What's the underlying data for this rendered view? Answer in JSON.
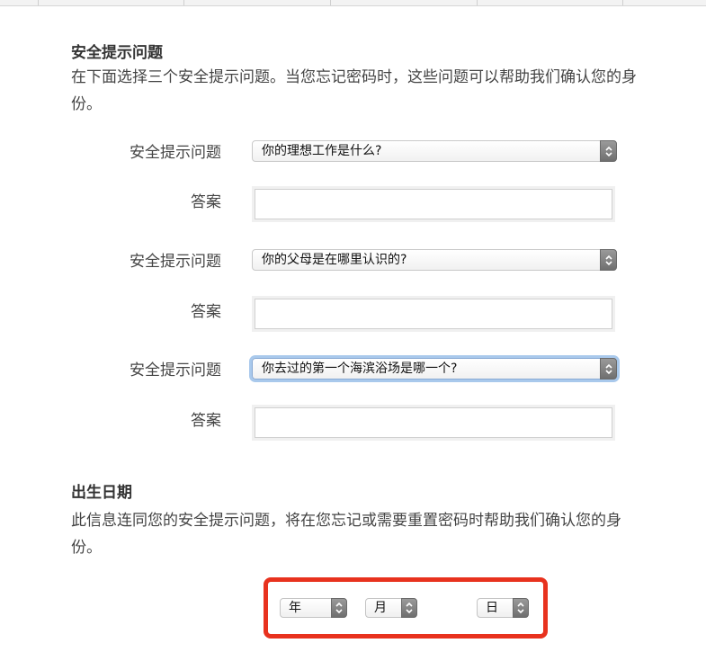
{
  "security": {
    "title": "安全提示问题",
    "description": "在下面选择三个安全提示问题。当您忘记密码时，这些问题可以帮助我们确认您的身份。",
    "questions": [
      {
        "label": "安全提示问题",
        "selected": "你的理想工作是什么?",
        "answer_label": "答案",
        "answer_value": ""
      },
      {
        "label": "安全提示问题",
        "selected": "你的父母是在哪里认识的?",
        "answer_label": "答案",
        "answer_value": ""
      },
      {
        "label": "安全提示问题",
        "selected": "你去过的第一个海滨浴场是哪一个?",
        "answer_label": "答案",
        "answer_value": ""
      }
    ]
  },
  "birthdate": {
    "title": "出生日期",
    "description": "此信息连同您的安全提示问题，将在您忘记或需要重置密码时帮助我们确认您的身份。",
    "year_label": "年",
    "month_label": "月",
    "day_label": "日"
  },
  "colors": {
    "highlight": "#e8321e",
    "focus_ring": "#a9c9ec"
  },
  "icons": {
    "stepper": "up-down-chevron-icon"
  }
}
